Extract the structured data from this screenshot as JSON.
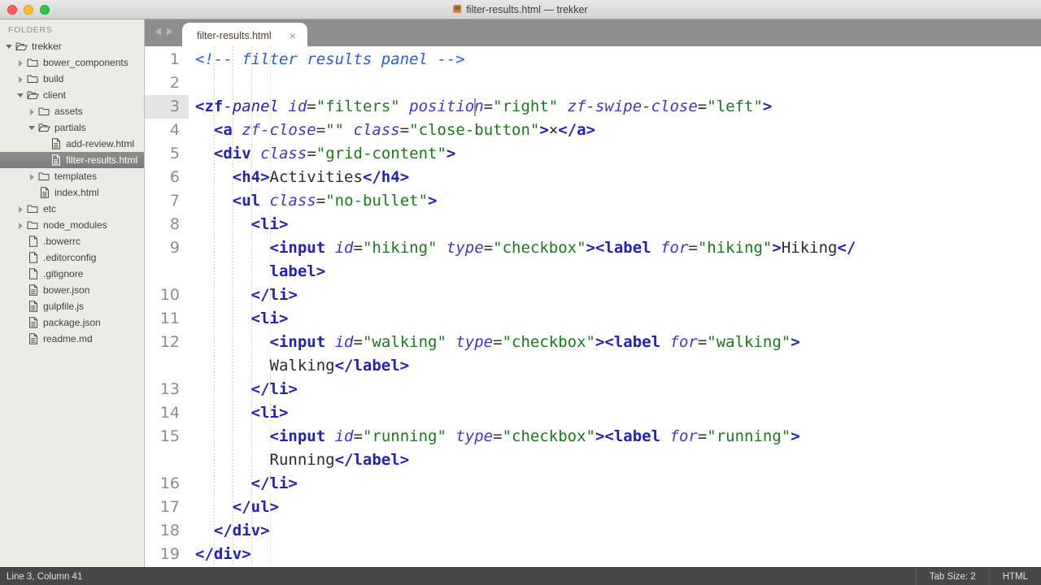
{
  "window": {
    "title": "filter-results.html — trekker",
    "app_icon": "sublime-text-icon",
    "controls": [
      "close",
      "minimize",
      "maximize"
    ]
  },
  "sidebar": {
    "header": "FOLDERS",
    "items": [
      {
        "label": "trekker",
        "depth": 0,
        "type": "folder",
        "state": "open",
        "selected": false
      },
      {
        "label": "bower_components",
        "depth": 1,
        "type": "folder",
        "state": "closed",
        "selected": false
      },
      {
        "label": "build",
        "depth": 1,
        "type": "folder",
        "state": "closed",
        "selected": false
      },
      {
        "label": "client",
        "depth": 1,
        "type": "folder",
        "state": "open",
        "selected": false
      },
      {
        "label": "assets",
        "depth": 2,
        "type": "folder",
        "state": "closed",
        "selected": false
      },
      {
        "label": "partials",
        "depth": 2,
        "type": "folder",
        "state": "open",
        "selected": false
      },
      {
        "label": "add-review.html",
        "depth": 3,
        "type": "file-html",
        "state": "none",
        "selected": false
      },
      {
        "label": "filter-results.html",
        "depth": 3,
        "type": "file-html",
        "state": "none",
        "selected": true
      },
      {
        "label": "templates",
        "depth": 2,
        "type": "folder",
        "state": "closed",
        "selected": false
      },
      {
        "label": "index.html",
        "depth": 2,
        "type": "file-html",
        "state": "none",
        "selected": false
      },
      {
        "label": "etc",
        "depth": 1,
        "type": "folder",
        "state": "closed",
        "selected": false
      },
      {
        "label": "node_modules",
        "depth": 1,
        "type": "folder",
        "state": "closed",
        "selected": false
      },
      {
        "label": ".bowerrc",
        "depth": 1,
        "type": "file",
        "state": "none",
        "selected": false
      },
      {
        "label": ".editorconfig",
        "depth": 1,
        "type": "file",
        "state": "none",
        "selected": false
      },
      {
        "label": ".gitignore",
        "depth": 1,
        "type": "file",
        "state": "none",
        "selected": false
      },
      {
        "label": "bower.json",
        "depth": 1,
        "type": "file-json",
        "state": "none",
        "selected": false
      },
      {
        "label": "gulpfile.js",
        "depth": 1,
        "type": "file-js",
        "state": "none",
        "selected": false
      },
      {
        "label": "package.json",
        "depth": 1,
        "type": "file-json",
        "state": "none",
        "selected": false
      },
      {
        "label": "readme.md",
        "depth": 1,
        "type": "file-md",
        "state": "none",
        "selected": false
      }
    ]
  },
  "tabs": {
    "nav_back": "◀",
    "nav_forward": "▶",
    "items": [
      {
        "label": "filter-results.html",
        "close": "×",
        "active": true
      }
    ]
  },
  "editor": {
    "cursor": {
      "line": 3,
      "column": 41
    },
    "lines": [
      {
        "num": "1",
        "tokens": [
          {
            "c": "t-comment",
            "t": "<!-- filter results panel -->"
          }
        ]
      },
      {
        "num": "2",
        "tokens": []
      },
      {
        "num": "3",
        "active": true,
        "cursor_after": 30,
        "tokens": [
          {
            "c": "t-tag",
            "t": "<zf"
          },
          {
            "c": "t-tagname",
            "t": "-panel "
          },
          {
            "c": "t-attr",
            "t": "id"
          },
          {
            "c": "t-eq",
            "t": "="
          },
          {
            "c": "t-str",
            "t": "\"filters\""
          },
          {
            "c": "t-text",
            "t": " "
          },
          {
            "c": "t-attr",
            "t": "position"
          },
          {
            "c": "t-eq",
            "t": "="
          },
          {
            "c": "t-str",
            "t": "\"right\""
          },
          {
            "c": "t-text",
            "t": " "
          },
          {
            "c": "t-attr",
            "t": "zf-swipe-close"
          },
          {
            "c": "t-eq",
            "t": "="
          },
          {
            "c": "t-str",
            "t": "\"left\""
          },
          {
            "c": "t-tag",
            "t": ">"
          }
        ]
      },
      {
        "num": "4",
        "indent": 1,
        "tokens": [
          {
            "c": "t-text",
            "t": "  "
          },
          {
            "c": "t-tag",
            "t": "<a"
          },
          {
            "c": "t-text",
            "t": " "
          },
          {
            "c": "t-attr",
            "t": "zf-close"
          },
          {
            "c": "t-eq",
            "t": "="
          },
          {
            "c": "t-str",
            "t": "\"\""
          },
          {
            "c": "t-text",
            "t": " "
          },
          {
            "c": "t-attr",
            "t": "class"
          },
          {
            "c": "t-eq",
            "t": "="
          },
          {
            "c": "t-str",
            "t": "\"close-button\""
          },
          {
            "c": "t-tag",
            "t": ">"
          },
          {
            "c": "t-text",
            "t": "×"
          },
          {
            "c": "t-tag",
            "t": "</a>"
          }
        ]
      },
      {
        "num": "5",
        "indent": 1,
        "tokens": [
          {
            "c": "t-text",
            "t": "  "
          },
          {
            "c": "t-tag",
            "t": "<div"
          },
          {
            "c": "t-text",
            "t": " "
          },
          {
            "c": "t-attr",
            "t": "class"
          },
          {
            "c": "t-eq",
            "t": "="
          },
          {
            "c": "t-str",
            "t": "\"grid-content\""
          },
          {
            "c": "t-tag",
            "t": ">"
          }
        ]
      },
      {
        "num": "6",
        "indent": 2,
        "tokens": [
          {
            "c": "t-text",
            "t": "    "
          },
          {
            "c": "t-tag",
            "t": "<h4>"
          },
          {
            "c": "t-text",
            "t": "Activities"
          },
          {
            "c": "t-tag",
            "t": "</h4>"
          }
        ]
      },
      {
        "num": "7",
        "indent": 2,
        "tokens": [
          {
            "c": "t-text",
            "t": "    "
          },
          {
            "c": "t-tag",
            "t": "<ul"
          },
          {
            "c": "t-text",
            "t": " "
          },
          {
            "c": "t-attr",
            "t": "class"
          },
          {
            "c": "t-eq",
            "t": "="
          },
          {
            "c": "t-str",
            "t": "\"no-bullet\""
          },
          {
            "c": "t-tag",
            "t": ">"
          }
        ]
      },
      {
        "num": "8",
        "indent": 3,
        "tokens": [
          {
            "c": "t-text",
            "t": "      "
          },
          {
            "c": "t-tag",
            "t": "<li>"
          }
        ]
      },
      {
        "num": "9",
        "indent": 4,
        "tokens": [
          {
            "c": "t-text",
            "t": "        "
          },
          {
            "c": "t-tag",
            "t": "<input"
          },
          {
            "c": "t-text",
            "t": " "
          },
          {
            "c": "t-attr",
            "t": "id"
          },
          {
            "c": "t-eq",
            "t": "="
          },
          {
            "c": "t-str",
            "t": "\"hiking\""
          },
          {
            "c": "t-text",
            "t": " "
          },
          {
            "c": "t-attr",
            "t": "type"
          },
          {
            "c": "t-eq",
            "t": "="
          },
          {
            "c": "t-str",
            "t": "\"checkbox\""
          },
          {
            "c": "t-tag",
            "t": ">"
          },
          {
            "c": "t-tag",
            "t": "<label"
          },
          {
            "c": "t-text",
            "t": " "
          },
          {
            "c": "t-attr",
            "t": "for"
          },
          {
            "c": "t-eq",
            "t": "="
          },
          {
            "c": "t-str",
            "t": "\"hiking\""
          },
          {
            "c": "t-tag",
            "t": ">"
          },
          {
            "c": "t-text",
            "t": "Hiking"
          },
          {
            "c": "t-tag",
            "t": "</"
          }
        ]
      },
      {
        "num": "",
        "indent": 4,
        "wrapped": true,
        "tokens": [
          {
            "c": "t-text",
            "t": "        "
          },
          {
            "c": "t-tag",
            "t": "label>"
          }
        ]
      },
      {
        "num": "10",
        "indent": 3,
        "tokens": [
          {
            "c": "t-text",
            "t": "      "
          },
          {
            "c": "t-tag",
            "t": "</li>"
          }
        ]
      },
      {
        "num": "11",
        "indent": 3,
        "tokens": [
          {
            "c": "t-text",
            "t": "      "
          },
          {
            "c": "t-tag",
            "t": "<li>"
          }
        ]
      },
      {
        "num": "12",
        "indent": 4,
        "tokens": [
          {
            "c": "t-text",
            "t": "        "
          },
          {
            "c": "t-tag",
            "t": "<input"
          },
          {
            "c": "t-text",
            "t": " "
          },
          {
            "c": "t-attr",
            "t": "id"
          },
          {
            "c": "t-eq",
            "t": "="
          },
          {
            "c": "t-str",
            "t": "\"walking\""
          },
          {
            "c": "t-text",
            "t": " "
          },
          {
            "c": "t-attr",
            "t": "type"
          },
          {
            "c": "t-eq",
            "t": "="
          },
          {
            "c": "t-str",
            "t": "\"checkbox\""
          },
          {
            "c": "t-tag",
            "t": ">"
          },
          {
            "c": "t-tag",
            "t": "<label"
          },
          {
            "c": "t-text",
            "t": " "
          },
          {
            "c": "t-attr",
            "t": "for"
          },
          {
            "c": "t-eq",
            "t": "="
          },
          {
            "c": "t-str",
            "t": "\"walking\""
          },
          {
            "c": "t-tag",
            "t": ">"
          }
        ]
      },
      {
        "num": "",
        "indent": 4,
        "wrapped": true,
        "tokens": [
          {
            "c": "t-text",
            "t": "        "
          },
          {
            "c": "t-text",
            "t": "Walking"
          },
          {
            "c": "t-tag",
            "t": "</label>"
          }
        ]
      },
      {
        "num": "13",
        "indent": 3,
        "tokens": [
          {
            "c": "t-text",
            "t": "      "
          },
          {
            "c": "t-tag",
            "t": "</li>"
          }
        ]
      },
      {
        "num": "14",
        "indent": 3,
        "tokens": [
          {
            "c": "t-text",
            "t": "      "
          },
          {
            "c": "t-tag",
            "t": "<li>"
          }
        ]
      },
      {
        "num": "15",
        "indent": 4,
        "tokens": [
          {
            "c": "t-text",
            "t": "        "
          },
          {
            "c": "t-tag",
            "t": "<input"
          },
          {
            "c": "t-text",
            "t": " "
          },
          {
            "c": "t-attr",
            "t": "id"
          },
          {
            "c": "t-eq",
            "t": "="
          },
          {
            "c": "t-str",
            "t": "\"running\""
          },
          {
            "c": "t-text",
            "t": " "
          },
          {
            "c": "t-attr",
            "t": "type"
          },
          {
            "c": "t-eq",
            "t": "="
          },
          {
            "c": "t-str",
            "t": "\"checkbox\""
          },
          {
            "c": "t-tag",
            "t": ">"
          },
          {
            "c": "t-tag",
            "t": "<label"
          },
          {
            "c": "t-text",
            "t": " "
          },
          {
            "c": "t-attr",
            "t": "for"
          },
          {
            "c": "t-eq",
            "t": "="
          },
          {
            "c": "t-str",
            "t": "\"running\""
          },
          {
            "c": "t-tag",
            "t": ">"
          }
        ]
      },
      {
        "num": "",
        "indent": 4,
        "wrapped": true,
        "tokens": [
          {
            "c": "t-text",
            "t": "        "
          },
          {
            "c": "t-text",
            "t": "Running"
          },
          {
            "c": "t-tag",
            "t": "</label>"
          }
        ]
      },
      {
        "num": "16",
        "indent": 3,
        "tokens": [
          {
            "c": "t-text",
            "t": "      "
          },
          {
            "c": "t-tag",
            "t": "</li>"
          }
        ]
      },
      {
        "num": "17",
        "indent": 2,
        "tokens": [
          {
            "c": "t-text",
            "t": "    "
          },
          {
            "c": "t-tag",
            "t": "</ul>"
          }
        ]
      },
      {
        "num": "18",
        "indent": 1,
        "tokens": [
          {
            "c": "t-text",
            "t": "  "
          },
          {
            "c": "t-tag",
            "t": "</div>"
          }
        ]
      },
      {
        "num": "19",
        "indent": 0,
        "tokens": [
          {
            "c": "t-tag",
            "t": "</div>"
          }
        ]
      }
    ]
  },
  "statusbar": {
    "position": "Line 3, Column 41",
    "tab_size": "Tab Size: 2",
    "syntax": "HTML"
  },
  "colors": {
    "comment": "#2b5df5",
    "tag": "#2222bb",
    "attribute": "#3a3ad0",
    "string": "#1a7a1a",
    "text": "#2b2b2b",
    "sidebar_bg": "#edebe6",
    "selection_bg": "#8e8e8e",
    "tabstrip_bg": "#8e8e8e",
    "statusbar_bg": "#474747"
  }
}
